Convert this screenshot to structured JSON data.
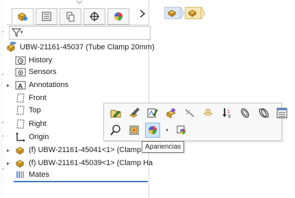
{
  "tooltip": "Apariencias",
  "tree": {
    "root": "UBW-21161-45037 (Tube Clamp 20mm)",
    "items": [
      {
        "label": "History",
        "icon": "history-folder-icon"
      },
      {
        "label": "Sensors",
        "icon": "sensors-folder-icon"
      },
      {
        "label": "Annotations",
        "icon": "annotations-folder-icon",
        "expandable": true
      },
      {
        "label": "Front",
        "icon": "front-plane-icon"
      },
      {
        "label": "Top",
        "icon": "top-plane-icon"
      },
      {
        "label": "Right",
        "icon": "right-plane-icon"
      },
      {
        "label": "Origin",
        "icon": "origin-icon"
      },
      {
        "label": "(f) UBW-21161-45041<1> (Clamp H",
        "icon": "part-icon",
        "expandable": true
      },
      {
        "label": "(f) UBW-21161-45039<1> (Clamp Ha",
        "icon": "part-icon",
        "expandable": true
      },
      {
        "label": "Mates",
        "icon": "mates-icon"
      }
    ]
  },
  "panel_tabs": [
    "feature-manager-tab",
    "property-manager-tab",
    "configuration-manager-tab",
    "dimxpert-manager-tab",
    "display-manager-tab"
  ],
  "context_toolbar": {
    "row1": [
      "edit-feature-icon",
      "edit-part-icon",
      "edit-sketch-icon",
      "configure-component-icon",
      "hide-icon",
      "make-transparent-icon",
      "fix-icon",
      "isolate-icon",
      "view-mates-icon",
      "component-properties-icon"
    ],
    "row2": [
      "zoom-to-selection-icon",
      "normal-to-icon",
      "appearances-icon",
      "appearance-dropdown-icon",
      "render-component-icon"
    ]
  }
}
